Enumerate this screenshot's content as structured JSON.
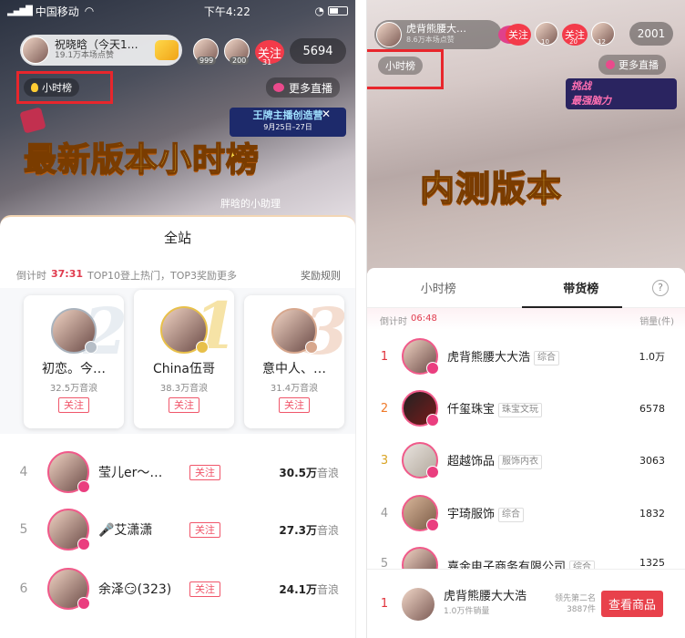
{
  "left": {
    "status": {
      "carrier": "中国移动",
      "time": "下午4:22"
    },
    "host": {
      "name": "祝晓晗（今天1…",
      "likes": "19.1万本场点赞"
    },
    "viewers": [
      {
        "badge": "999"
      },
      {
        "badge": "200"
      }
    ],
    "follow_label": "关注",
    "follow_badge": "31",
    "viewer_count": "5694",
    "hour_rank_tag": "小时榜",
    "more_live": "更多直播",
    "overlay_title": "最新版本小时榜",
    "event_banner": {
      "title": "王牌主播创造营",
      "dates": "9月25日–27日"
    },
    "watermark": "胖晗的小助理",
    "panel": {
      "title": "全站",
      "countdown_label": "倒计时",
      "countdown": "37:31",
      "countdown_desc": "TOP10登上热门，TOP3奖励更多",
      "rules": "奖励规则",
      "top3": [
        {
          "rank": "2",
          "name": "初恋。今…",
          "score": "32.5万音浪",
          "follow": "关注"
        },
        {
          "rank": "1",
          "name": "China伍哥",
          "score": "38.3万音浪",
          "follow": "关注"
        },
        {
          "rank": "3",
          "name": "意中人、…",
          "score": "31.4万音浪",
          "follow": "关注"
        }
      ],
      "list": [
        {
          "rank": "4",
          "name": "莹儿er～…",
          "follow": "关注",
          "score": "30.5万",
          "unit": "音浪"
        },
        {
          "rank": "5",
          "name": "🎤艾潇潇",
          "follow": "关注",
          "score": "27.3万",
          "unit": "音浪"
        },
        {
          "rank": "6",
          "name": "余泽😏(323)",
          "follow": "关注",
          "score": "24.1万",
          "unit": "音浪"
        }
      ]
    }
  },
  "right": {
    "host": {
      "name": "虎背熊腰大…",
      "likes": "8.6万本场点赞"
    },
    "follow_label": "关注",
    "viewers": [
      {
        "badge": "10"
      },
      {
        "badge": "20"
      },
      {
        "badge": "12"
      }
    ],
    "viewer_count": "2001",
    "hour_rank_tag": "小时榜",
    "more_live": "更多直播",
    "challenge_banner": {
      "line1": "挑战",
      "line2": "最强脑力"
    },
    "overlay_title": "内测版本",
    "panel": {
      "tabs": [
        "小时榜",
        "带货榜"
      ],
      "help_icon": "?",
      "countdown_label": "倒计时",
      "countdown": "06:48",
      "sales_label": "销量(件)",
      "list": [
        {
          "rank": "1",
          "name": "虎背熊腰大大浩",
          "tag": "综合",
          "sales": "1.0万"
        },
        {
          "rank": "2",
          "name": "仟玺珠宝",
          "tag": "珠宝文玩",
          "sales": "6578"
        },
        {
          "rank": "3",
          "name": "超越饰品",
          "tag": "服饰内衣",
          "sales": "3063"
        },
        {
          "rank": "4",
          "name": "宇琦服饰",
          "tag": "综合",
          "sales": "1832"
        },
        {
          "rank": "5",
          "name": "嘉金电子商务有限公司",
          "tag": "综合",
          "sales": "1325"
        }
      ],
      "footer": {
        "rank": "1",
        "name": "虎背熊腰大大浩",
        "sales": "1.0万件销量",
        "lead_label": "领先第二名",
        "lead_value": "3887件",
        "button": "查看商品"
      }
    }
  },
  "colors": {
    "accent": "#f0566a",
    "follow_red": "#f33b4a",
    "gold": "#c9a23b"
  }
}
